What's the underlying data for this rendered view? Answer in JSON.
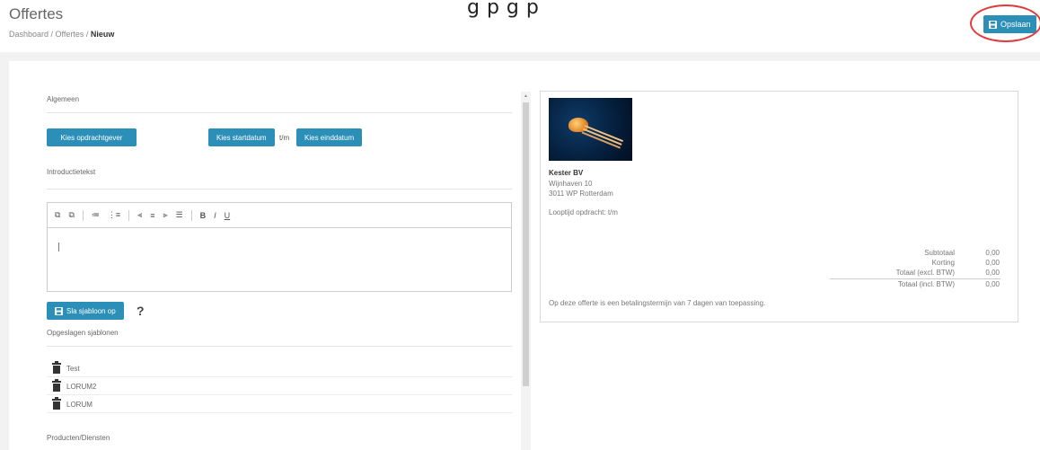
{
  "top_overlay_text": "g                 p  g   p",
  "header": {
    "title": "Offertes",
    "breadcrumb": [
      "Dashboard",
      "Offertes",
      "Nieuw"
    ],
    "save_label": "Opslaan"
  },
  "form": {
    "general_label": "Algemeen",
    "choose_client": "Kies opdrachtgever",
    "choose_start": "Kies startdatum",
    "tm": "t/m",
    "choose_end": "Kies einddatum",
    "intro_label": "Introductietekst",
    "toolbar": [
      "⧉",
      "⧉",
      "≔",
      "⋮≡",
      "⫷",
      "≡",
      "⫸",
      "☰",
      "B",
      "I",
      "U"
    ],
    "save_template": "Sla sjabloon op",
    "help": "?",
    "saved_templates_label": "Opgeslagen sjablonen",
    "templates": [
      "Test",
      "LORUM2",
      "LORUM"
    ],
    "products_label": "Producten/Diensten"
  },
  "preview": {
    "company": "Kester BV",
    "street": "Wijnhaven 10",
    "city": "3011 WP Rotterdam",
    "term": "Looptijd opdracht: t/m",
    "totals": [
      {
        "label": "Subtotaal",
        "value": "0,00"
      },
      {
        "label": "Korting",
        "value": "0,00"
      },
      {
        "label": "Totaal (excl. BTW)",
        "value": "0,00"
      },
      {
        "label": "Totaal (incl. BTW)",
        "value": "0,00"
      }
    ],
    "payment": "Op deze offerte is een betalingstermijn van 7 dagen van toepassing."
  },
  "colors": {
    "accent": "#2c8fb8",
    "highlight": "#e23b3b"
  }
}
